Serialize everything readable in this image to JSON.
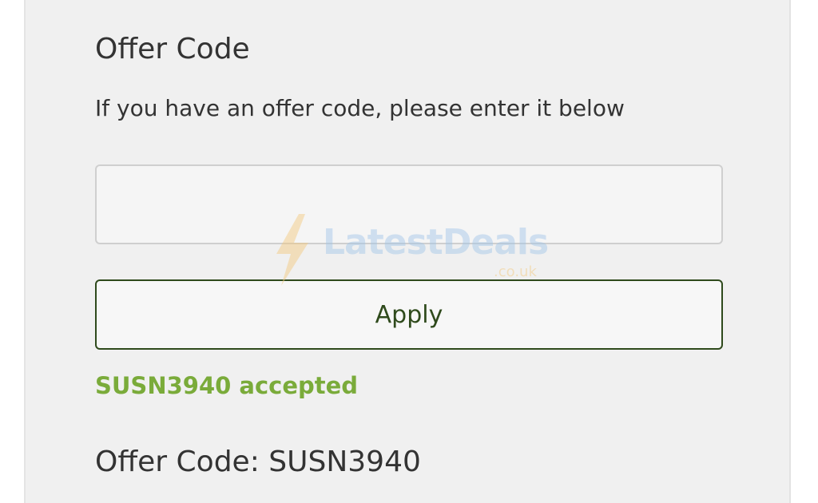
{
  "offer_section": {
    "title": "Offer Code",
    "instructions": "If you have an offer code, please enter it below",
    "input": {
      "value": "",
      "placeholder": ""
    },
    "apply_label": "Apply",
    "status_message": "SUSN3940 accepted",
    "applied_label": "Offer Code:",
    "applied_value": "SUSN3940"
  },
  "watermark": {
    "name": "LatestDeals",
    "suffix": ".co.uk",
    "icon": "lightning-bolt-icon"
  },
  "colors": {
    "panel_background": "#f0f0f0",
    "button_border": "#2f4a1c",
    "success_text": "#7aab3a",
    "text": "#333333"
  }
}
